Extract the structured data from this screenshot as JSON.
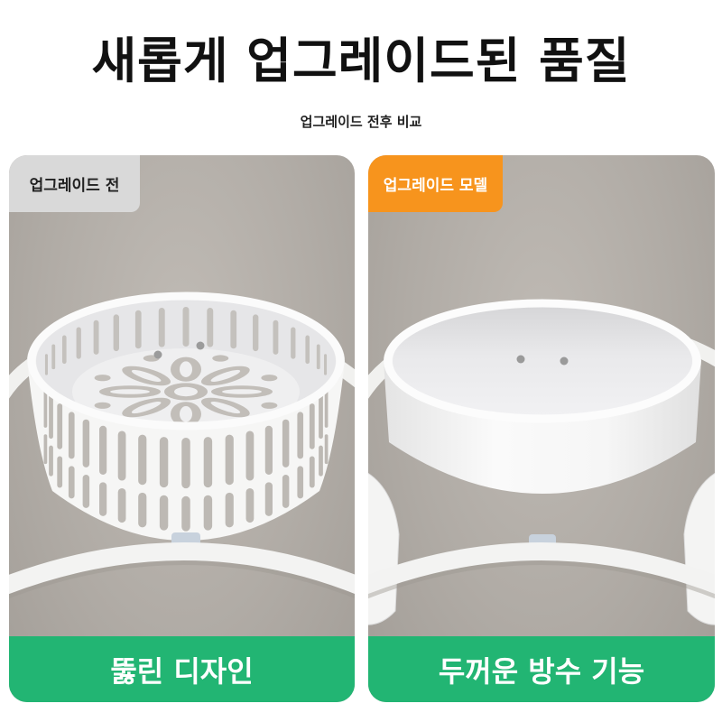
{
  "title": "새롭게 업그레이드된 품질",
  "subtitle": "업그레이드 전후 비교",
  "panels": [
    {
      "tag": "업그레이드 전",
      "caption": "뚫린 디자인"
    },
    {
      "tag": "업그레이드 모델",
      "caption": "두꺼운 방수 기능"
    }
  ],
  "colors": {
    "tag_before": "#d9d9d9",
    "tag_after": "#f7941d",
    "caption_bg": "#22b573",
    "caption_text": "#ffffff",
    "page_bg": "#ffffff"
  }
}
